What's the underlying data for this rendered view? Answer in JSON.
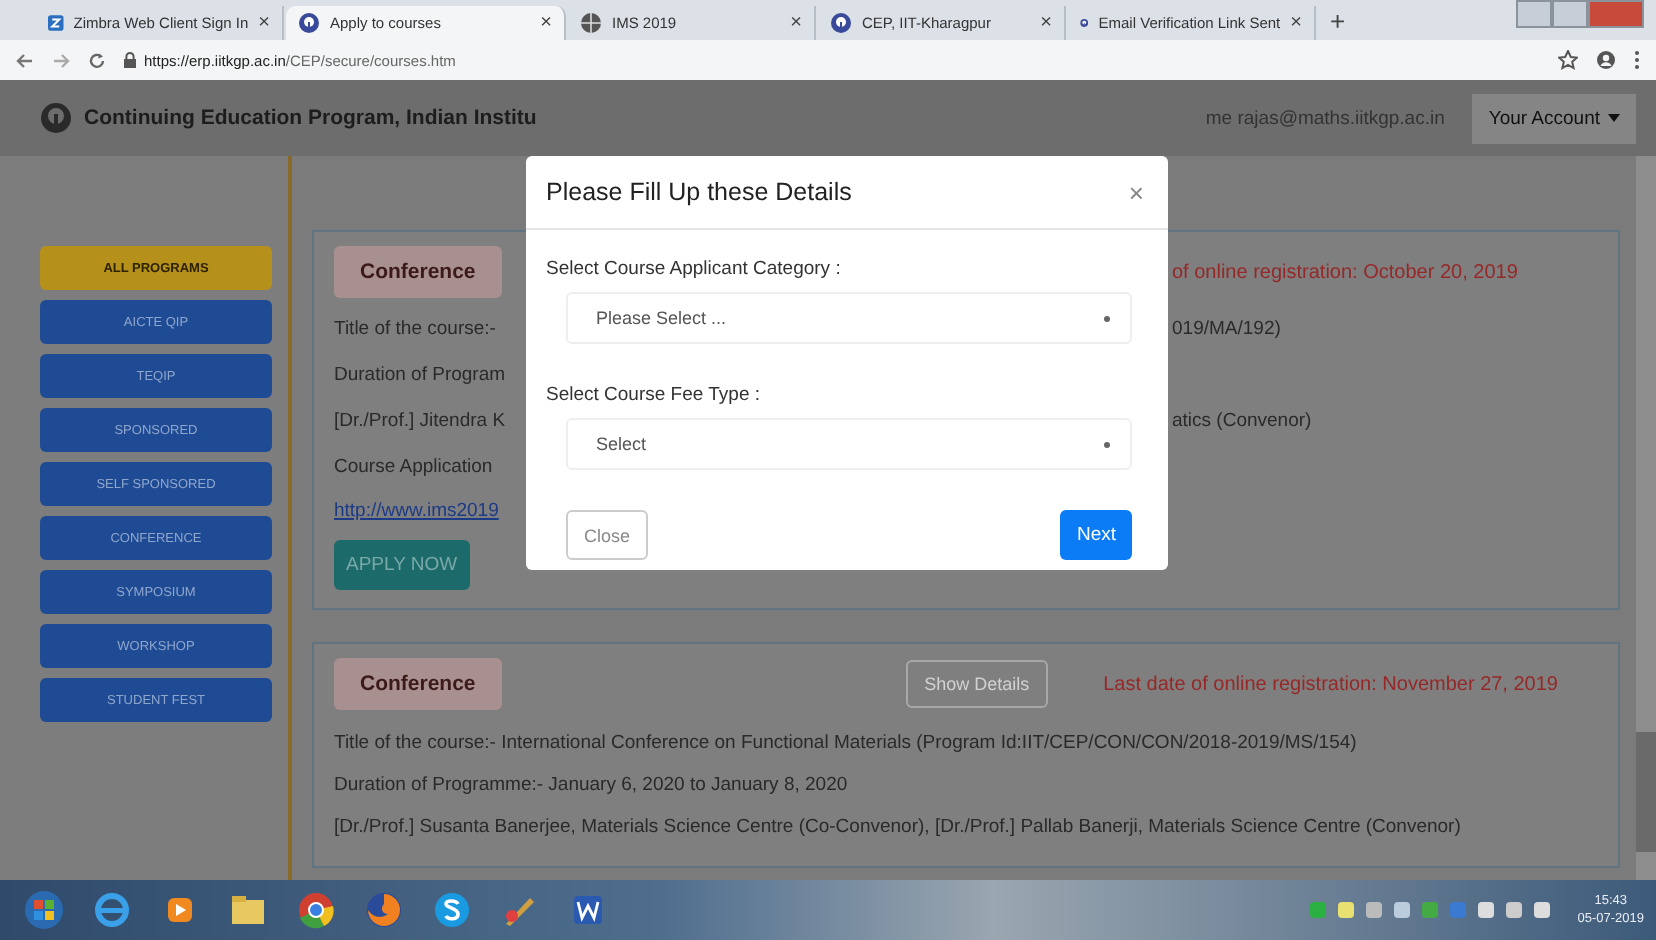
{
  "browser": {
    "tabs": [
      {
        "title": "Zimbra Web Client Sign In",
        "selected": false
      },
      {
        "title": "Apply to courses",
        "selected": true
      },
      {
        "title": "IMS 2019",
        "selected": false
      },
      {
        "title": "CEP, IIT-Kharagpur",
        "selected": false
      },
      {
        "title": "Email Verification Link Sent",
        "selected": false
      }
    ],
    "tab_close": "×",
    "new_tab": "+",
    "url_host": "https://erp.iitkgp.ac.in",
    "url_path": "/CEP/secure/courses.htm"
  },
  "site_header": {
    "title": "Continuing Education Program, Indian Institu",
    "welcome": "me rajas@maths.iitkgp.ac.in",
    "account_button": "Your Account"
  },
  "sidebar": {
    "items": [
      {
        "label": "ALL PROGRAMS",
        "selected": true
      },
      {
        "label": "AICTE QIP",
        "selected": false
      },
      {
        "label": "TEQIP",
        "selected": false
      },
      {
        "label": "SPONSORED",
        "selected": false
      },
      {
        "label": "SELF SPONSORED",
        "selected": false
      },
      {
        "label": "CONFERENCE",
        "selected": false
      },
      {
        "label": "SYMPOSIUM",
        "selected": false
      },
      {
        "label": "WORKSHOP",
        "selected": false
      },
      {
        "label": "STUDENT FEST",
        "selected": false
      }
    ]
  },
  "courses": [
    {
      "category": "Conference",
      "deadline": "of online registration: October 20, 2019",
      "lines": [
        {
          "left": "Title of the course:-",
          "right": "019/MA/192)"
        },
        {
          "left": "Duration of Program"
        },
        {
          "left": "[Dr./Prof.] Jitendra K",
          "right": "atics (Convenor)"
        },
        {
          "left": "Course Application"
        }
      ],
      "link": "http://www.ims2019",
      "apply_button": "APPLY NOW"
    },
    {
      "category": "Conference",
      "show_details": "Show Details",
      "deadline": "Last date of online registration: November 27, 2019",
      "lines": [
        {
          "left": "Title of the course:- International Conference on Functional Materials (Program Id:IIT/CEP/CON/CON/2018-2019/MS/154)"
        },
        {
          "left": "Duration of Programme:- January 6, 2020 to January 8, 2020"
        },
        {
          "left": "[Dr./Prof.] Susanta Banerjee, Materials Science Centre (Co-Convenor), [Dr./Prof.] Pallab Banerji, Materials Science Centre (Convenor)"
        }
      ]
    }
  ],
  "modal": {
    "title": "Please Fill Up these Details",
    "close_icon": "×",
    "fields": [
      {
        "label": "Select Course Applicant Category :",
        "value": "Please Select ..."
      },
      {
        "label": "Select Course Fee Type :",
        "value": "Select"
      }
    ],
    "close_button": "Close",
    "next_button": "Next"
  },
  "taskbar": {
    "time": "15:43",
    "date": "05-07-2019"
  }
}
